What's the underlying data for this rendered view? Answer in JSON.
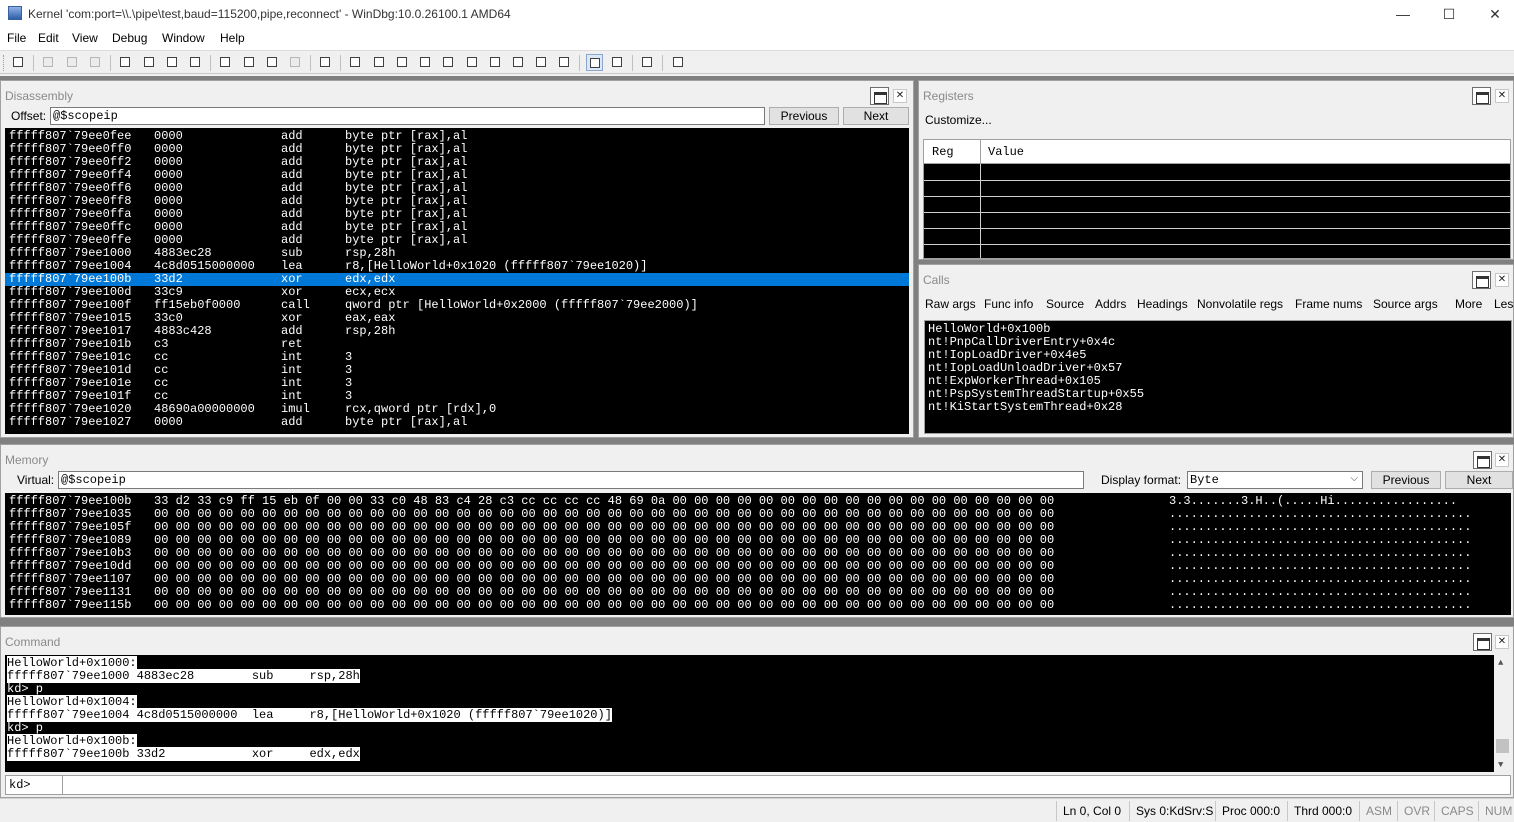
{
  "window": {
    "title": "Kernel 'com:port=\\\\.\\pipe\\test,baud=115200,pipe,reconnect' - WinDbg:10.0.26100.1 AMD64",
    "minimize": "—",
    "maximize": "☐",
    "close": "✕"
  },
  "menu": [
    "File",
    "Edit",
    "View",
    "Debug",
    "Window",
    "Help"
  ],
  "toolbar_icons": [
    "open-icon",
    "cut-icon",
    "copy-icon",
    "paste-icon",
    "go-icon",
    "restart-icon",
    "stop-debugging-icon",
    "break-icon",
    "step-into-icon",
    "step-over-icon",
    "step-out-icon",
    "run-to-cursor-icon",
    "insert-breakpoint-icon",
    "command-window-icon",
    "watch-window-icon",
    "locals-window-icon",
    "registers-window-icon",
    "memory-window-icon",
    "call-stack-window-icon",
    "disassembly-window-icon",
    "scratch-pad-icon",
    "source-mode-icon",
    "hex-mode-icon",
    "font-icon",
    "options-icon"
  ],
  "disassembly": {
    "title": "Disassembly",
    "offset_label": "Offset:",
    "offset_value": "@$scopeip",
    "previous": "Previous",
    "next": "Next",
    "rows": [
      {
        "addr": "fffff807`79ee0fee",
        "bytes": "0000",
        "op": "add",
        "args": "byte ptr [rax],al"
      },
      {
        "addr": "fffff807`79ee0ff0",
        "bytes": "0000",
        "op": "add",
        "args": "byte ptr [rax],al"
      },
      {
        "addr": "fffff807`79ee0ff2",
        "bytes": "0000",
        "op": "add",
        "args": "byte ptr [rax],al"
      },
      {
        "addr": "fffff807`79ee0ff4",
        "bytes": "0000",
        "op": "add",
        "args": "byte ptr [rax],al"
      },
      {
        "addr": "fffff807`79ee0ff6",
        "bytes": "0000",
        "op": "add",
        "args": "byte ptr [rax],al"
      },
      {
        "addr": "fffff807`79ee0ff8",
        "bytes": "0000",
        "op": "add",
        "args": "byte ptr [rax],al"
      },
      {
        "addr": "fffff807`79ee0ffa",
        "bytes": "0000",
        "op": "add",
        "args": "byte ptr [rax],al"
      },
      {
        "addr": "fffff807`79ee0ffc",
        "bytes": "0000",
        "op": "add",
        "args": "byte ptr [rax],al"
      },
      {
        "addr": "fffff807`79ee0ffe",
        "bytes": "0000",
        "op": "add",
        "args": "byte ptr [rax],al"
      },
      {
        "addr": "fffff807`79ee1000",
        "bytes": "4883ec28",
        "op": "sub",
        "args": "rsp,28h"
      },
      {
        "addr": "fffff807`79ee1004",
        "bytes": "4c8d0515000000",
        "op": "lea",
        "args": "r8,[HelloWorld+0x1020 (fffff807`79ee1020)]"
      },
      {
        "addr": "fffff807`79ee100b",
        "bytes": "33d2",
        "op": "xor",
        "args": "edx,edx"
      },
      {
        "addr": "fffff807`79ee100d",
        "bytes": "33c9",
        "op": "xor",
        "args": "ecx,ecx"
      },
      {
        "addr": "fffff807`79ee100f",
        "bytes": "ff15eb0f0000",
        "op": "call",
        "args": "qword ptr [HelloWorld+0x2000 (fffff807`79ee2000)]"
      },
      {
        "addr": "fffff807`79ee1015",
        "bytes": "33c0",
        "op": "xor",
        "args": "eax,eax"
      },
      {
        "addr": "fffff807`79ee1017",
        "bytes": "4883c428",
        "op": "add",
        "args": "rsp,28h"
      },
      {
        "addr": "fffff807`79ee101b",
        "bytes": "c3",
        "op": "ret",
        "args": ""
      },
      {
        "addr": "fffff807`79ee101c",
        "bytes": "cc",
        "op": "int",
        "args": "3"
      },
      {
        "addr": "fffff807`79ee101d",
        "bytes": "cc",
        "op": "int",
        "args": "3"
      },
      {
        "addr": "fffff807`79ee101e",
        "bytes": "cc",
        "op": "int",
        "args": "3"
      },
      {
        "addr": "fffff807`79ee101f",
        "bytes": "cc",
        "op": "int",
        "args": "3"
      },
      {
        "addr": "fffff807`79ee1020",
        "bytes": "48690a00000000",
        "op": "imul",
        "args": "rcx,qword ptr [rdx],0"
      },
      {
        "addr": "fffff807`79ee1027",
        "bytes": "0000",
        "op": "add",
        "args": "byte ptr [rax],al"
      }
    ],
    "selected_row": 11
  },
  "registers": {
    "title": "Registers",
    "customize": "Customize...",
    "col_reg": "Reg",
    "col_value": "Value"
  },
  "calls": {
    "title": "Calls",
    "tabs": [
      "Raw args",
      "Func info",
      "Source",
      "Addrs",
      "Headings",
      "Nonvolatile regs",
      "Frame nums",
      "Source args",
      "More",
      "Less"
    ],
    "frames": [
      "HelloWorld+0x100b",
      "nt!PnpCallDriverEntry+0x4c",
      "nt!IopLoadDriver+0x4e5",
      "nt!IopLoadUnloadDriver+0x57",
      "nt!ExpWorkerThread+0x105",
      "nt!PspSystemThreadStartup+0x55",
      "nt!KiStartSystemThread+0x28"
    ]
  },
  "memory": {
    "title": "Memory",
    "virtual_label": "Virtual:",
    "virtual_value": "@$scopeip",
    "display_format_label": "Display format:",
    "display_format_value": "Byte",
    "previous": "Previous",
    "next": "Next",
    "rows": [
      {
        "addr": "fffff807`79ee100b",
        "hex": "33 d2 33 c9 ff 15 eb 0f 00 00 33 c0 48 83 c4 28 c3 cc cc cc cc 48 69 0a 00 00 00 00 00 00 00 00 00 00 00 00 00 00 00 00 00 00",
        "ascii": "3.3.......3.H..(.....Hi................."
      },
      {
        "addr": "fffff807`79ee1035",
        "hex": "00 00 00 00 00 00 00 00 00 00 00 00 00 00 00 00 00 00 00 00 00 00 00 00 00 00 00 00 00 00 00 00 00 00 00 00 00 00 00 00 00 00",
        "ascii": ".........................................."
      },
      {
        "addr": "fffff807`79ee105f",
        "hex": "00 00 00 00 00 00 00 00 00 00 00 00 00 00 00 00 00 00 00 00 00 00 00 00 00 00 00 00 00 00 00 00 00 00 00 00 00 00 00 00 00 00",
        "ascii": ".........................................."
      },
      {
        "addr": "fffff807`79ee1089",
        "hex": "00 00 00 00 00 00 00 00 00 00 00 00 00 00 00 00 00 00 00 00 00 00 00 00 00 00 00 00 00 00 00 00 00 00 00 00 00 00 00 00 00 00",
        "ascii": ".........................................."
      },
      {
        "addr": "fffff807`79ee10b3",
        "hex": "00 00 00 00 00 00 00 00 00 00 00 00 00 00 00 00 00 00 00 00 00 00 00 00 00 00 00 00 00 00 00 00 00 00 00 00 00 00 00 00 00 00",
        "ascii": ".........................................."
      },
      {
        "addr": "fffff807`79ee10dd",
        "hex": "00 00 00 00 00 00 00 00 00 00 00 00 00 00 00 00 00 00 00 00 00 00 00 00 00 00 00 00 00 00 00 00 00 00 00 00 00 00 00 00 00 00",
        "ascii": ".........................................."
      },
      {
        "addr": "fffff807`79ee1107",
        "hex": "00 00 00 00 00 00 00 00 00 00 00 00 00 00 00 00 00 00 00 00 00 00 00 00 00 00 00 00 00 00 00 00 00 00 00 00 00 00 00 00 00 00",
        "ascii": ".........................................."
      },
      {
        "addr": "fffff807`79ee1131",
        "hex": "00 00 00 00 00 00 00 00 00 00 00 00 00 00 00 00 00 00 00 00 00 00 00 00 00 00 00 00 00 00 00 00 00 00 00 00 00 00 00 00 00 00",
        "ascii": ".........................................."
      },
      {
        "addr": "fffff807`79ee115b",
        "hex": "00 00 00 00 00 00 00 00 00 00 00 00 00 00 00 00 00 00 00 00 00 00 00 00 00 00 00 00 00 00 00 00 00 00 00 00 00 00 00 00 00 00",
        "ascii": ".........................................."
      }
    ]
  },
  "command": {
    "title": "Command",
    "lines": [
      "HelloWorld+0x1000:",
      "fffff807`79ee1000 4883ec28        sub     rsp,28h",
      "kd> p",
      "HelloWorld+0x1004:",
      "fffff807`79ee1004 4c8d0515000000  lea     r8,[HelloWorld+0x1020 (fffff807`79ee1020)]",
      "kd> p",
      "HelloWorld+0x100b:",
      "fffff807`79ee100b 33d2            xor     edx,edx"
    ],
    "prompt": "kd>",
    "input_value": ""
  },
  "status": {
    "position": "Ln 0, Col 0",
    "sys": "Sys 0:KdSrv:S",
    "proc": "Proc 000:0",
    "thrd": "Thrd 000:0",
    "asm": "ASM",
    "ovr": "OVR",
    "caps": "CAPS",
    "num": "NUM"
  }
}
